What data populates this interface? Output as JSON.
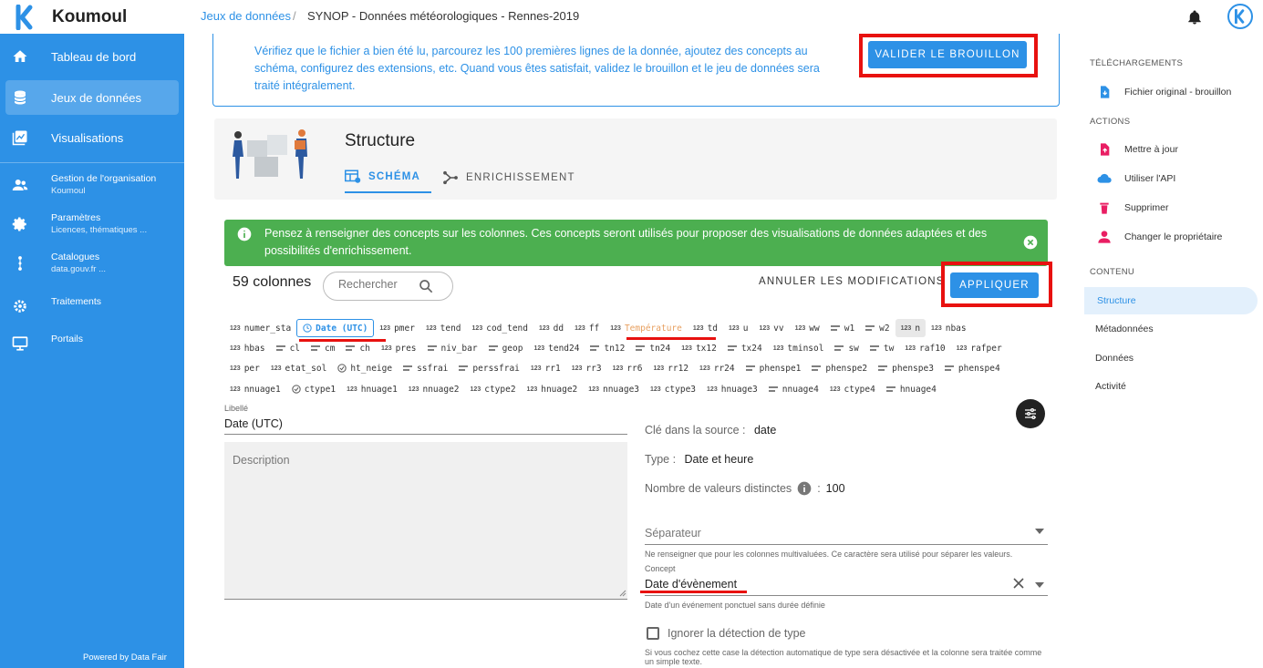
{
  "app": {
    "name": "Koumoul",
    "powered_by": "Powered by Data Fair"
  },
  "sidebar": {
    "items": [
      {
        "label": "Tableau de bord",
        "icon": "home-icon"
      },
      {
        "label": "Jeux de données",
        "icon": "database-icon"
      },
      {
        "label": "Visualisations",
        "icon": "chart-icon"
      }
    ],
    "sub_items": [
      {
        "label": "Gestion de l'organisation",
        "sub": "Koumoul",
        "icon": "people-icon"
      },
      {
        "label": "Paramètres",
        "sub": "Licences, thématiques ...",
        "icon": "gear-icon"
      },
      {
        "label": "Catalogues",
        "sub": "data.gouv.fr ...",
        "icon": "dots-icon"
      },
      {
        "label": "Traitements",
        "icon": "cogs-icon"
      },
      {
        "label": "Portails",
        "icon": "monitor-icon"
      }
    ]
  },
  "breadcrumb": {
    "parent": "Jeux de données",
    "separator": "/",
    "current": "SYNOP - Données météorologiques - Rennes-2019"
  },
  "info": {
    "text": "Vérifiez que le fichier a bien été lu, parcourez les 100 premières lignes de la donnée, ajoutez des concepts au schéma, configurez des extensions, etc. Quand vous êtes satisfait, validez le brouillon et le jeu de données sera traité intégralement.",
    "validate_label": "VALIDER LE BROUILLON"
  },
  "structure": {
    "title": "Structure",
    "tabs": [
      {
        "label": "SCHÉMA"
      },
      {
        "label": "ENRICHISSEMENT"
      }
    ]
  },
  "alert": {
    "text": "Pensez à renseigner des concepts sur les colonnes. Ces concepts seront utilisés pour proposer des visualisations de données adaptées et des possibilités d'enrichissement."
  },
  "columns": {
    "count_label": "59 colonnes",
    "search_placeholder": "Rechercher",
    "cancel_label": "ANNULER LES MODIFICATIONS",
    "apply_label": "APPLIQUER",
    "rows": [
      [
        [
          "123",
          "numer_sta"
        ],
        [
          "clock",
          "Date (UTC)",
          "selected"
        ],
        [
          "123",
          "pmer"
        ],
        [
          "123",
          "tend"
        ],
        [
          "123",
          "cod_tend"
        ],
        [
          "123",
          "dd"
        ],
        [
          "123",
          "ff"
        ],
        [
          "123",
          "Température",
          "temp"
        ],
        [
          "123",
          "td"
        ],
        [
          "123",
          "u"
        ],
        [
          "123",
          "vv"
        ],
        [
          "123",
          "ww"
        ],
        [
          "=",
          "w1"
        ],
        [
          "=",
          "w2"
        ],
        [
          "123",
          "n",
          "grey"
        ],
        [
          "123",
          "nbas"
        ]
      ],
      [
        [
          "123",
          "hbas"
        ],
        [
          "=",
          "cl"
        ],
        [
          "=",
          "cm"
        ],
        [
          "=",
          "ch"
        ],
        [
          "123",
          "pres"
        ],
        [
          "=",
          "niv_bar"
        ],
        [
          "=",
          "geop"
        ],
        [
          "123",
          "tend24"
        ],
        [
          "=",
          "tn12"
        ],
        [
          "=",
          "tn24"
        ],
        [
          "123",
          "tx12"
        ],
        [
          "=",
          "tx24"
        ],
        [
          "123",
          "tminsol"
        ],
        [
          "=",
          "sw"
        ],
        [
          "=",
          "tw"
        ],
        [
          "123",
          "raf10"
        ],
        [
          "123",
          "rafper"
        ]
      ],
      [
        [
          "123",
          "per"
        ],
        [
          "123",
          "etat_sol"
        ],
        [
          "check",
          "ht_neige"
        ],
        [
          "=",
          "ssfrai"
        ],
        [
          "=",
          "perssfrai"
        ],
        [
          "123",
          "rr1"
        ],
        [
          "123",
          "rr3"
        ],
        [
          "123",
          "rr6"
        ],
        [
          "123",
          "rr12"
        ],
        [
          "123",
          "rr24"
        ],
        [
          "=",
          "phenspe1"
        ],
        [
          "=",
          "phenspe2"
        ],
        [
          "=",
          "phenspe3"
        ],
        [
          "=",
          "phenspe4"
        ]
      ],
      [
        [
          "123",
          "nnuage1"
        ],
        [
          "check",
          "ctype1"
        ],
        [
          "123",
          "hnuage1"
        ],
        [
          "123",
          "nnuage2"
        ],
        [
          "123",
          "ctype2"
        ],
        [
          "123",
          "hnuage2"
        ],
        [
          "123",
          "nnuage3"
        ],
        [
          "123",
          "ctype3"
        ],
        [
          "123",
          "hnuage3"
        ],
        [
          "=",
          "nnuage4"
        ],
        [
          "123",
          "ctype4"
        ],
        [
          "=",
          "hnuage4"
        ]
      ]
    ]
  },
  "detail": {
    "libelle_label": "Libellé",
    "libelle_value": "Date (UTC)",
    "description_label": "Description",
    "source_key_label": "Clé dans la source :",
    "source_key_value": "date",
    "type_label": "Type :",
    "type_value": "Date et heure",
    "distinct_label": "Nombre de valeurs distinctes",
    "distinct_value": "100",
    "separator_label": "Séparateur",
    "separator_hint": "Ne renseigner que pour les colonnes multivaluées. Ce caractère sera utilisé pour séparer les valeurs.",
    "concept_label": "Concept",
    "concept_value": "Date d'évènement",
    "concept_hint": "Date d'un événement ponctuel sans durée définie",
    "ignore_label": "Ignorer la détection de type",
    "ignore_hint": "Si vous cochez cette case la détection automatique de type sera désactivée et la colonne sera traitée comme un simple texte."
  },
  "right_panel": {
    "downloads_title": "TÉLÉCHARGEMENTS",
    "download_item": "Fichier original - brouillon",
    "actions_title": "ACTIONS",
    "actions": [
      "Mettre à jour",
      "Utiliser l'API",
      "Supprimer",
      "Changer le propriétaire"
    ],
    "content_title": "CONTENU",
    "content": [
      "Structure",
      "Métadonnées",
      "Données",
      "Activité"
    ]
  },
  "colors": {
    "primary": "#2d91e6",
    "highlight": "#e8110f",
    "alert": "#4caf50",
    "danger": "#e91e63"
  }
}
